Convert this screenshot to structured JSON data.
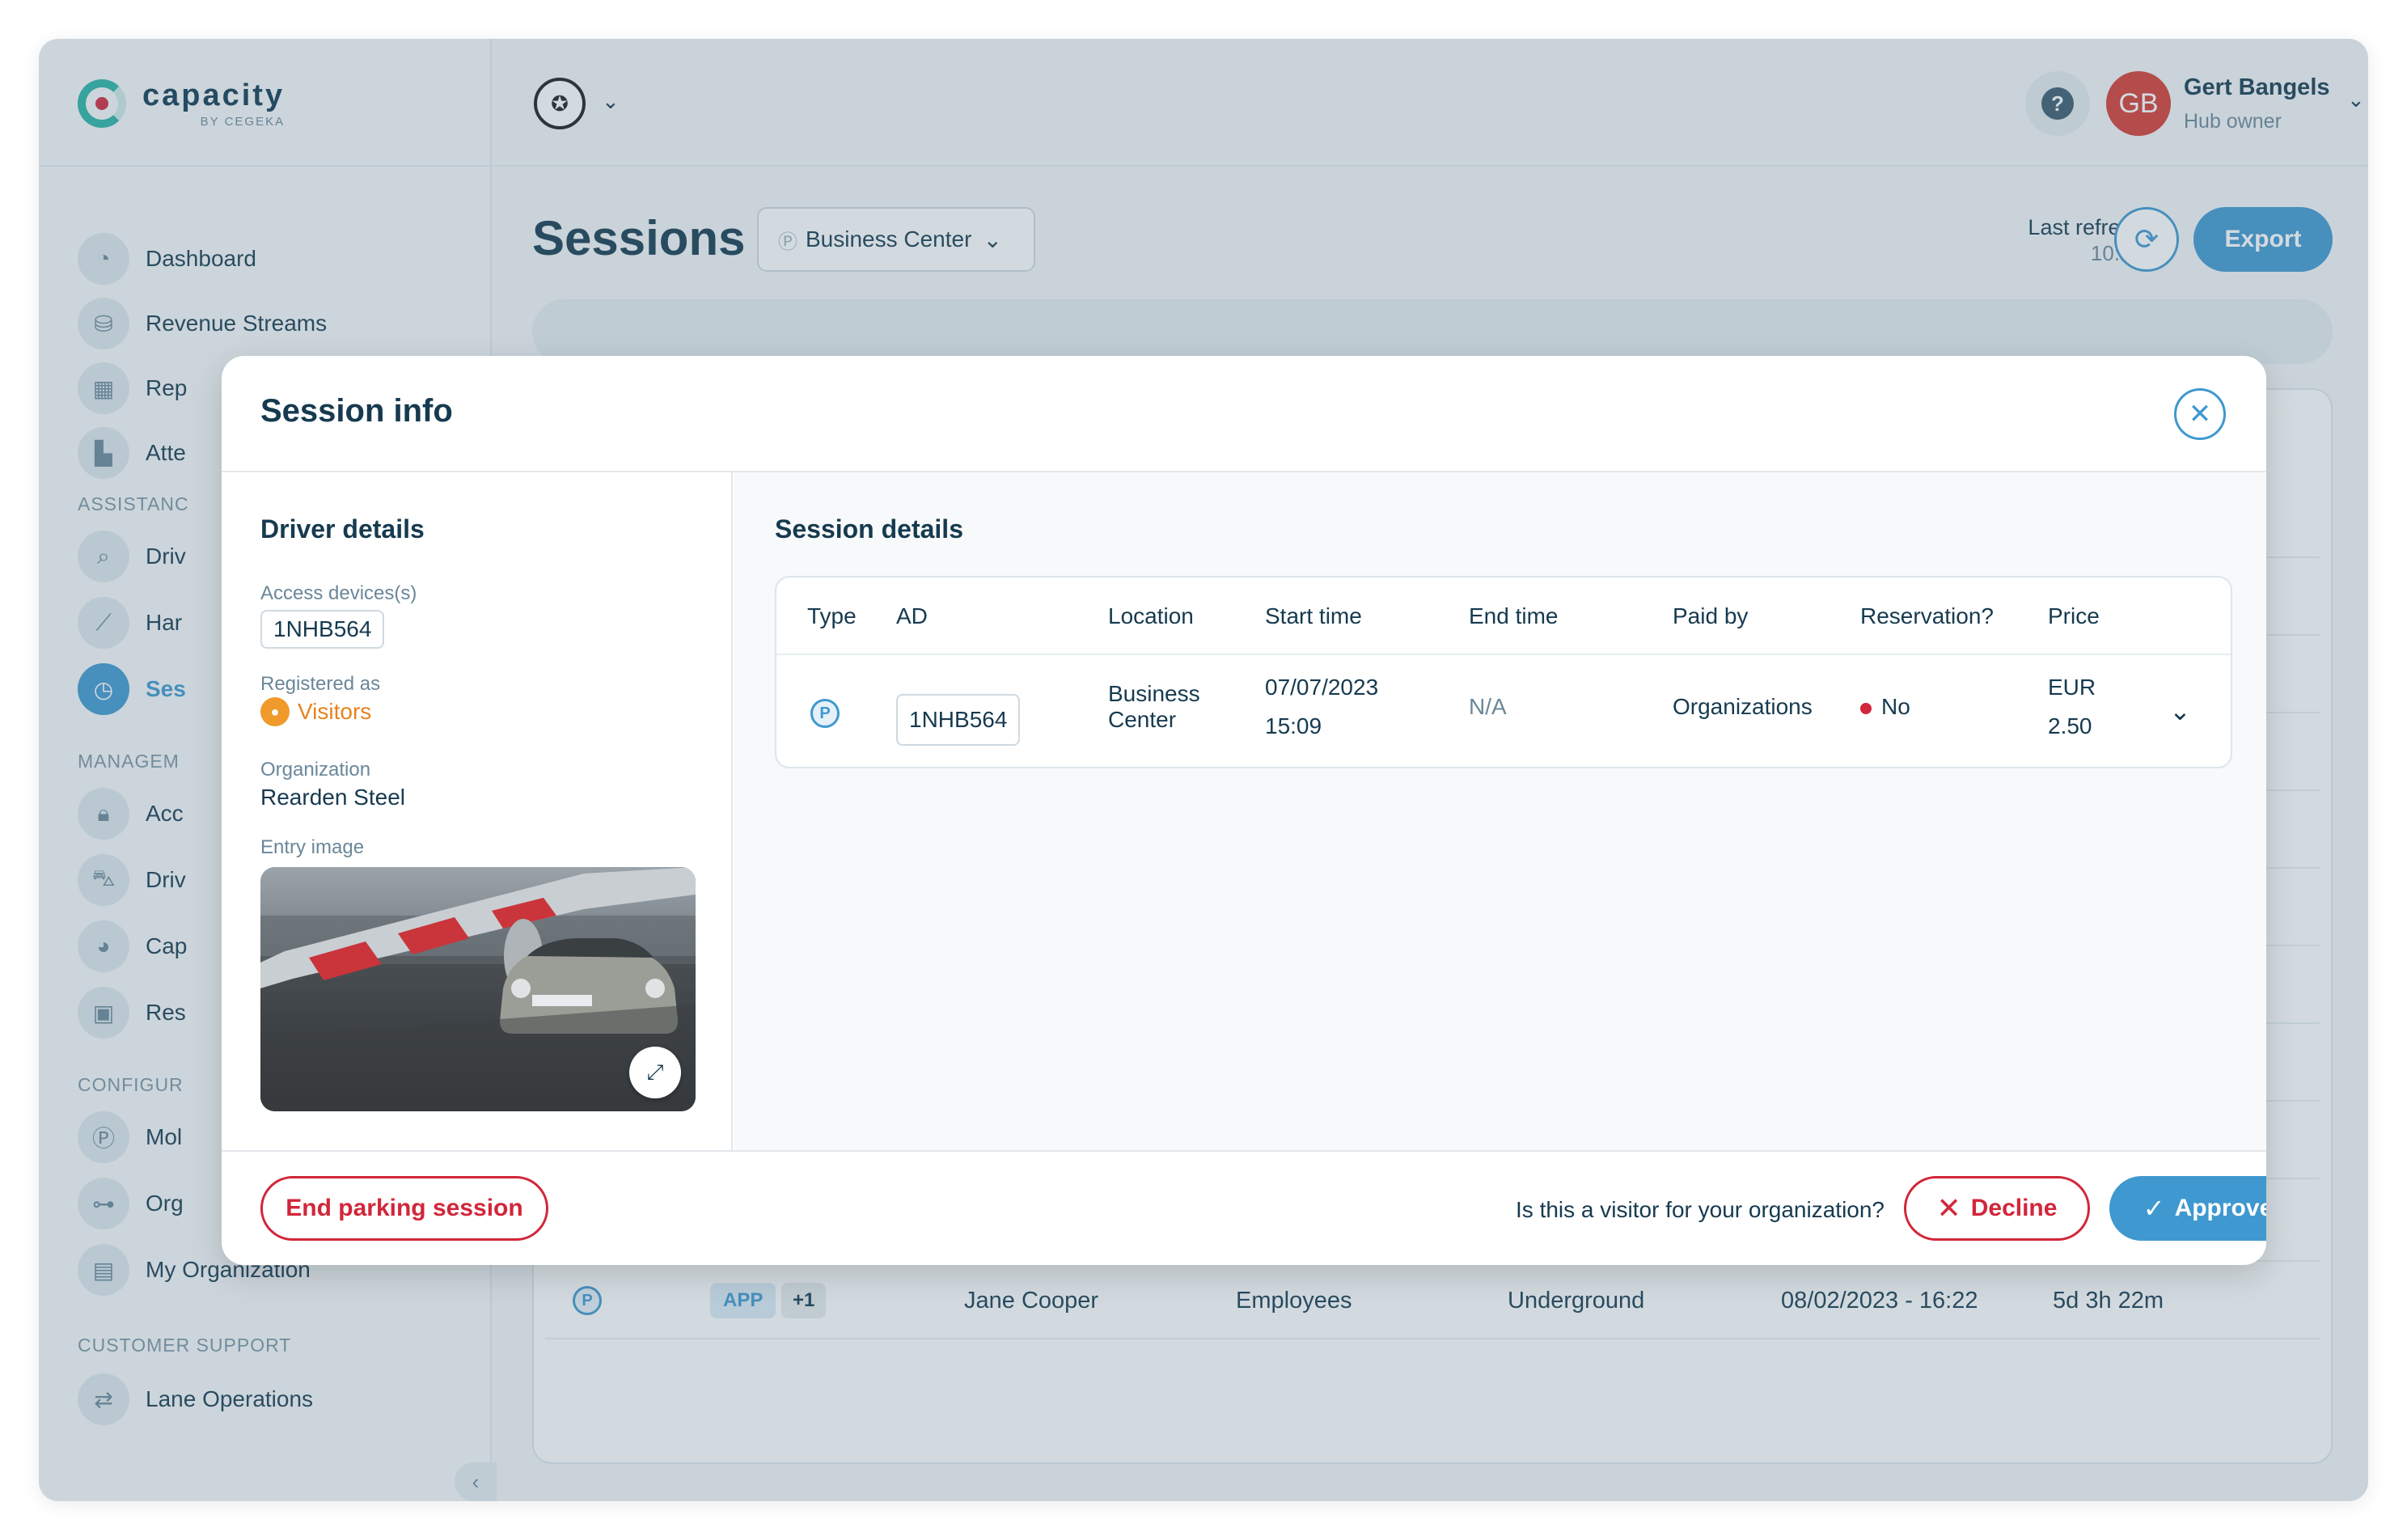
{
  "brand": {
    "name": "capacity",
    "sub": "BY CEGEKA"
  },
  "sidebar": {
    "items": [
      {
        "label": "Dashboard"
      },
      {
        "label": "Revenue Streams"
      },
      {
        "label": "Rep"
      },
      {
        "label": "Atte"
      },
      {
        "label": "Driv"
      },
      {
        "label": "Har"
      },
      {
        "label": "Ses"
      },
      {
        "label": "Acc"
      },
      {
        "label": "Driv"
      },
      {
        "label": "Cap"
      },
      {
        "label": "Res"
      },
      {
        "label": "Mol"
      },
      {
        "label": "Org"
      },
      {
        "label": "My Organization"
      },
      {
        "label": "Lane Operations"
      }
    ],
    "sections": {
      "assistance": "ASSISTANC",
      "management": "MANAGEM",
      "configuration": "CONFIGUR",
      "customer_support": "CUSTOMER SUPPORT"
    }
  },
  "header": {
    "help": "?",
    "user_initials": "GB",
    "user_name": "Gert Bangels",
    "user_role": "Hub owner"
  },
  "page": {
    "title": "Sessions",
    "location_select": "Business Center",
    "last_refresh_label": "Last refresh",
    "last_refresh_time": "10:21",
    "export_label": "Export"
  },
  "background_row": {
    "badge": "APP",
    "extra": "+1",
    "name": "Jane Cooper",
    "group": "Employees",
    "location": "Underground",
    "start": "08/02/2023 - 16:22",
    "duration": "5d 3h 22m"
  },
  "modal": {
    "title": "Session info",
    "driver": {
      "title": "Driver details",
      "access_label": "Access devices(s)",
      "access_value": "1NHB564",
      "registered_label": "Registered as",
      "registered_value": "Visitors",
      "org_label": "Organization",
      "org_value": "Rearden Steel",
      "image_label": "Entry image"
    },
    "session": {
      "title": "Session details",
      "headers": {
        "type": "Type",
        "ad": "AD",
        "location": "Location",
        "start": "Start time",
        "end": "End time",
        "paid": "Paid by",
        "reservation": "Reservation?",
        "price": "Price"
      },
      "row": {
        "type_icon": "P",
        "ad": "1NHB564",
        "location_1": "Business",
        "location_2": "Center",
        "start_date": "07/07/2023",
        "start_time": "15:09",
        "end": "N/A",
        "paid": "Organizations",
        "reservation": "No",
        "currency": "EUR",
        "price": "2.50"
      }
    },
    "footer": {
      "end_session": "End parking session",
      "question": "Is this a visitor for your organization?",
      "decline": "Decline",
      "approve": "Approve"
    }
  },
  "colors": {
    "accent": "#3f98cf",
    "danger": "#d2263a",
    "warning": "#f09a2b",
    "avatar": "#d53b33"
  }
}
